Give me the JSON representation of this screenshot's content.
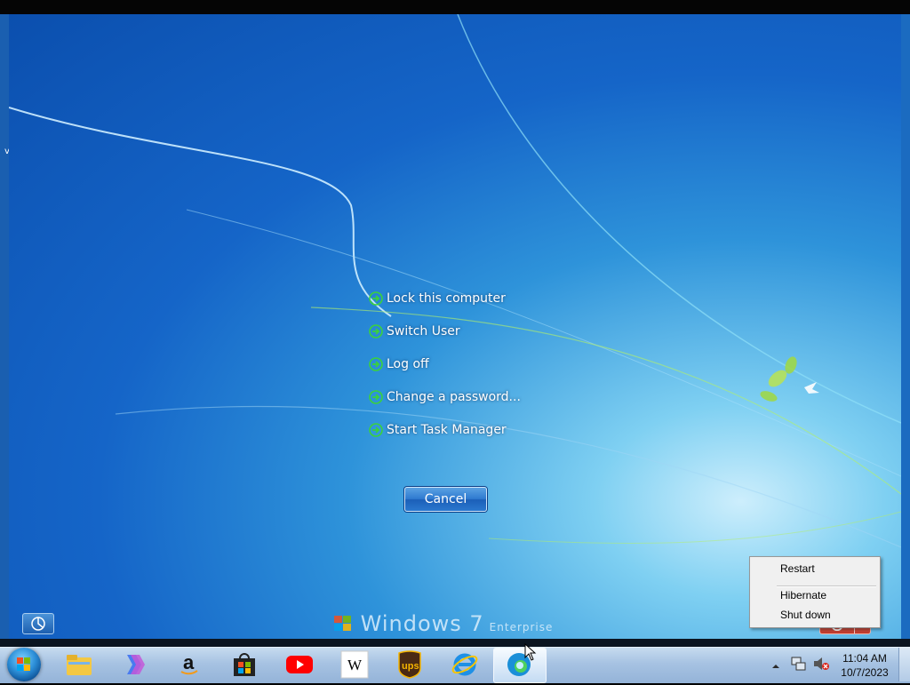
{
  "security_screen": {
    "options": [
      {
        "label": "Lock this computer"
      },
      {
        "label": "Switch User"
      },
      {
        "label": "Log off"
      },
      {
        "label": "Change a password..."
      },
      {
        "label": "Start Task Manager"
      }
    ],
    "cancel_label": "Cancel",
    "os_brand": "Windows 7",
    "os_edition": "Enterprise"
  },
  "power_menu": {
    "items": [
      "Restart",
      "Hibernate",
      "Shut down"
    ]
  },
  "desktop_edge_text": "v",
  "taskbar": {
    "pinned": [
      {
        "name": "file-explorer-icon"
      },
      {
        "name": "copilot-icon"
      },
      {
        "name": "amazon-icon"
      },
      {
        "name": "microsoft-store-icon"
      },
      {
        "name": "youtube-icon"
      },
      {
        "name": "wikipedia-icon"
      },
      {
        "name": "ups-icon"
      },
      {
        "name": "internet-explorer-icon"
      },
      {
        "name": "edge-icon"
      }
    ],
    "wikipedia_glyph": "W",
    "ups_glyph": "ups",
    "amazon_glyph": "a",
    "clock_time": "11:04 AM",
    "clock_date": "10/7/2023"
  },
  "colors": {
    "arrow_green": "#3bd23b",
    "power_red": "#c0392b",
    "wallpaper_blue": "#1565c8"
  }
}
